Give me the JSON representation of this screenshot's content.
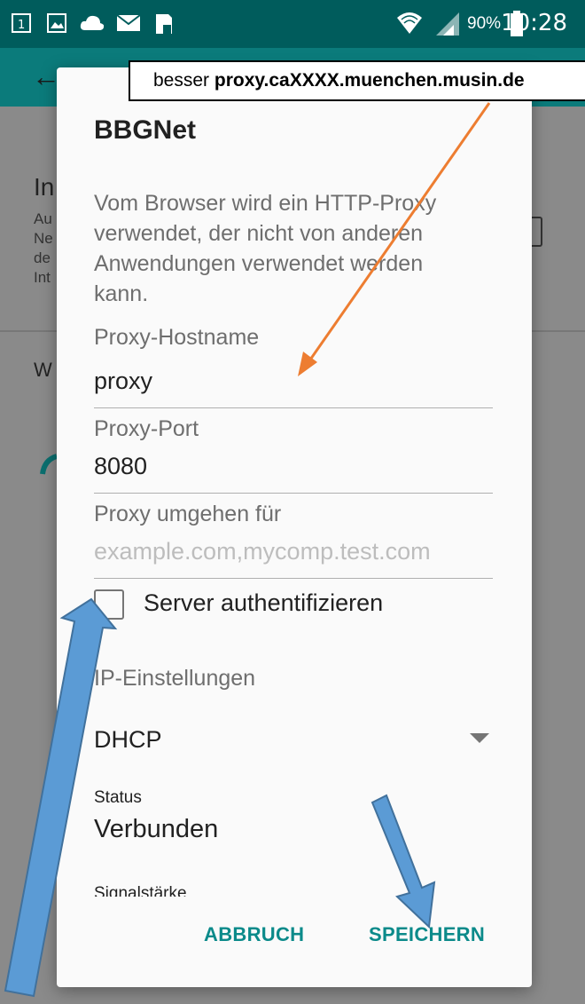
{
  "status_bar": {
    "battery": "90%",
    "time": "10:28"
  },
  "background": {
    "heading_fragment": "In",
    "desc_fragments": [
      "Au",
      "Ne",
      "de",
      "Int"
    ],
    "section_fragment": "W"
  },
  "dialog": {
    "title": "BBGNet",
    "description": "Vom Browser wird ein HTTP-Proxy verwendet, der nicht von anderen Anwendungen verwendet werden kann.",
    "proxy_hostname": {
      "label": "Proxy-Hostname",
      "value": "proxy"
    },
    "proxy_port": {
      "label": "Proxy-Port",
      "value": "8080"
    },
    "proxy_bypass": {
      "label": "Proxy umgehen für",
      "placeholder": "example.com,mycomp.test.com"
    },
    "server_auth": {
      "label": "Server authentifizieren",
      "checked": false
    },
    "ip_settings": {
      "label": "IP-Einstellungen",
      "value": "DHCP"
    },
    "status": {
      "label": "Status",
      "value": "Verbunden"
    },
    "signal_label": "Signalstärke",
    "cancel_label": "ABBRUCH",
    "save_label": "SPEICHERN"
  },
  "annotation": {
    "prefix": "besser ",
    "hostname": "proxy.caXXXX.muenchen.musin.de"
  },
  "colors": {
    "accent": "#0b8a8a",
    "callout_arrow": "#ed7d31",
    "highlight_arrow": "#5b9bd5"
  }
}
